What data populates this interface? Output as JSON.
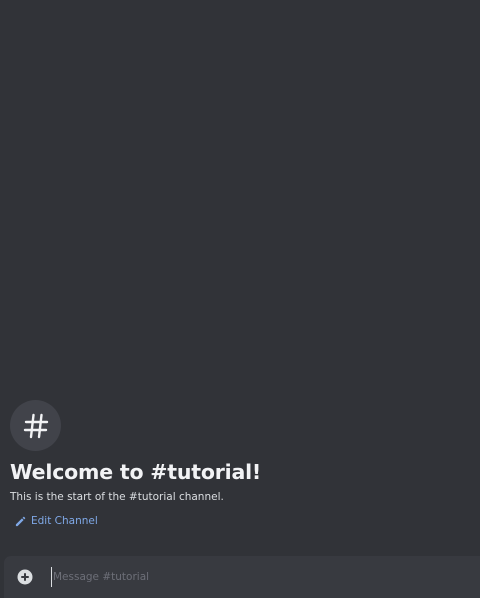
{
  "channel": {
    "name": "tutorial",
    "icon": "hash-icon"
  },
  "welcome": {
    "title": "Welcome to #tutorial!",
    "subtitle": "This is the start of the #tutorial channel.",
    "edit_label": "Edit Channel",
    "edit_icon": "pencil-icon"
  },
  "composer": {
    "attach_icon": "plus-circle-icon",
    "placeholder": "Message #tutorial",
    "value": ""
  },
  "colors": {
    "background": "#313338",
    "composer": "#383a40",
    "link": "#7fa8e6",
    "title": "#f2f3f5"
  }
}
